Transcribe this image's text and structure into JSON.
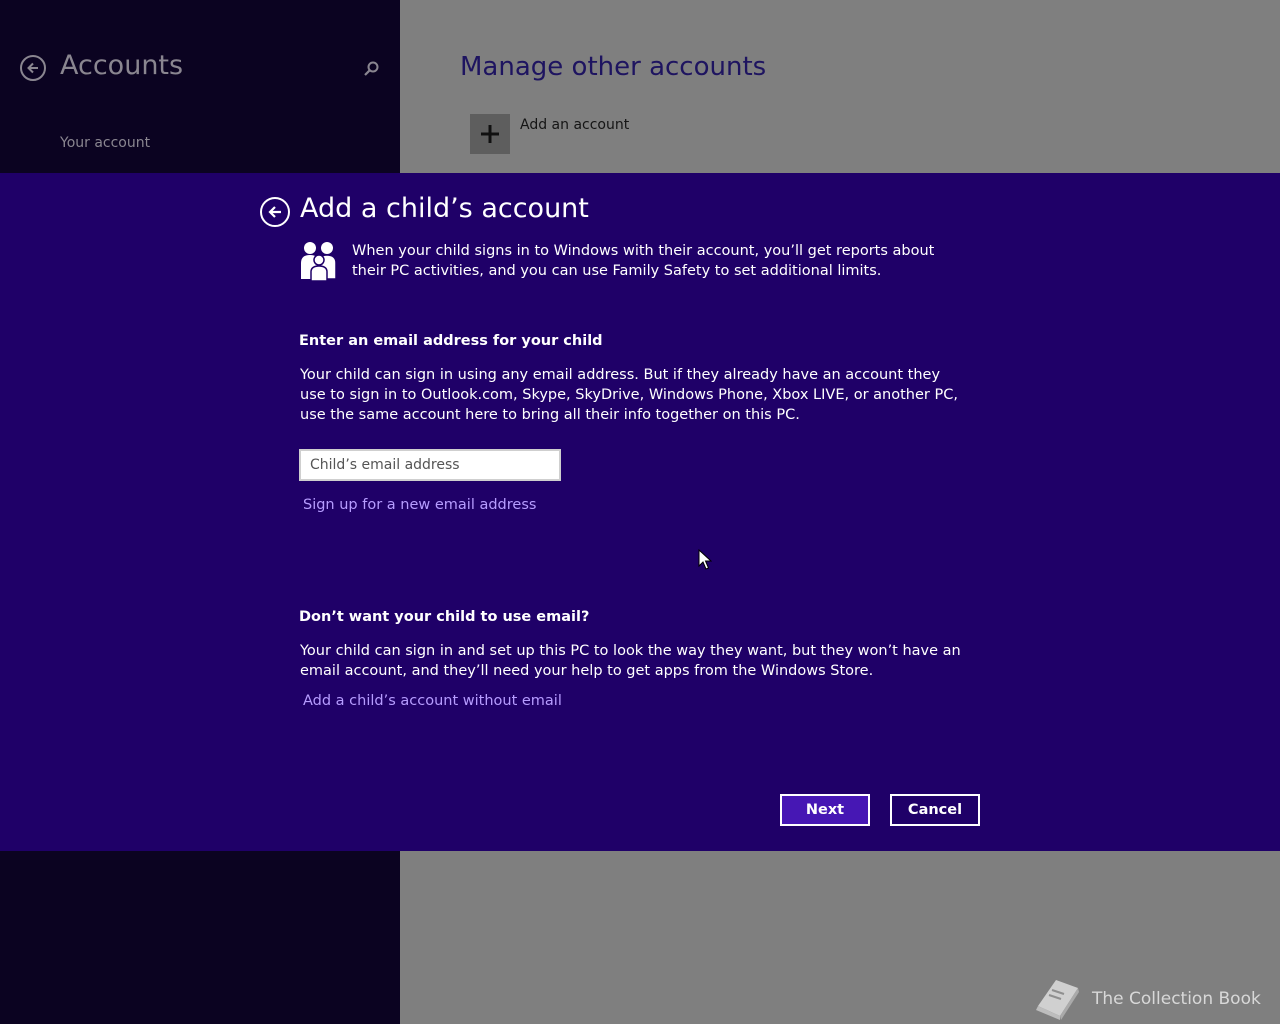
{
  "background_app": {
    "title": "Accounts",
    "nav_items": [
      "Your account"
    ],
    "main_heading": "Manage other accounts",
    "add_account_label": "Add an account"
  },
  "dialog": {
    "title": "Add a child’s account",
    "intro": "When your child signs in to Windows with their account, you’ll get reports about their PC activities, and you can use Family Safety to set additional limits.",
    "email_section": {
      "heading": "Enter an email address for your child",
      "body": "Your child can sign in using any email address. But if they already have an account they use to sign in to Outlook.com, Skype, SkyDrive, Windows Phone, Xbox LIVE, or another PC, use the same account here to bring all their info together on this PC.",
      "input_placeholder": "Child’s email address",
      "input_value": "",
      "signup_link": "Sign up for a new email address"
    },
    "no_email_section": {
      "heading": "Don’t want your child to use email?",
      "body": "Your child can sign in and set up this PC to look the way they want, but they won’t have an email account, and they’ll need your help to get apps from the Windows Store.",
      "link": "Add a child’s account without email"
    },
    "buttons": {
      "next": "Next",
      "cancel": "Cancel"
    }
  },
  "watermark": {
    "text": "The Collection Book"
  },
  "icons": [
    "back-arrow-icon",
    "search-icon",
    "plus-icon",
    "family-icon",
    "mouse-cursor-icon",
    "book-icon"
  ],
  "colors": {
    "dialog_bg": "#1f0068",
    "left_pane_bg": "#0b0321",
    "right_pane_bg": "#7f7f7f",
    "link": "#b69cff",
    "next_button_bg": "#4617b4",
    "text": "#ffffff"
  }
}
